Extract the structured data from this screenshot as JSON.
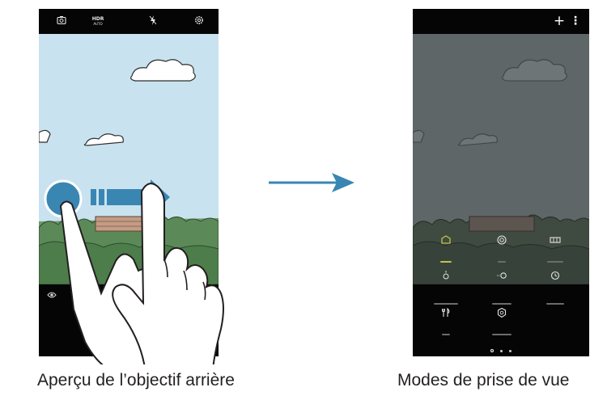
{
  "left_screen": {
    "hdr_label": "HDR",
    "hdr_sub": "AUTO",
    "icons": [
      "switch-camera-icon",
      "hdr-icon",
      "flash-off-icon",
      "settings-icon"
    ],
    "caption": "Aperçu de l’objectif arrière"
  },
  "right_screen": {
    "plus_symbol": "+",
    "more_symbol": "⋮",
    "modes": [
      {
        "name": "Auto",
        "icon": "auto-mode-icon",
        "active": true
      },
      {
        "name": "Pro",
        "icon": "pro-mode-icon",
        "active": false
      },
      {
        "name": "Panorama",
        "icon": "panorama-mode-icon",
        "active": false
      },
      {
        "name": "Selective focus",
        "icon": "selective-focus-icon",
        "active": false
      },
      {
        "name": "Slow motion",
        "icon": "slow-motion-icon",
        "active": false
      },
      {
        "name": "Hyperlapse",
        "icon": "hyperlapse-icon",
        "active": false
      },
      {
        "name": "Food",
        "icon": "food-mode-icon",
        "active": false
      },
      {
        "name": "Virtual shot",
        "icon": "virtual-shot-icon",
        "active": false
      }
    ],
    "page_dots": 3,
    "active_dot": 0,
    "caption": "Modes de prise de vue"
  },
  "colors": {
    "sky": "#c9e2ef",
    "arrow_blue": "#3a86b3",
    "active_mode": "#c2c24a",
    "overlay": "#5e6667"
  }
}
